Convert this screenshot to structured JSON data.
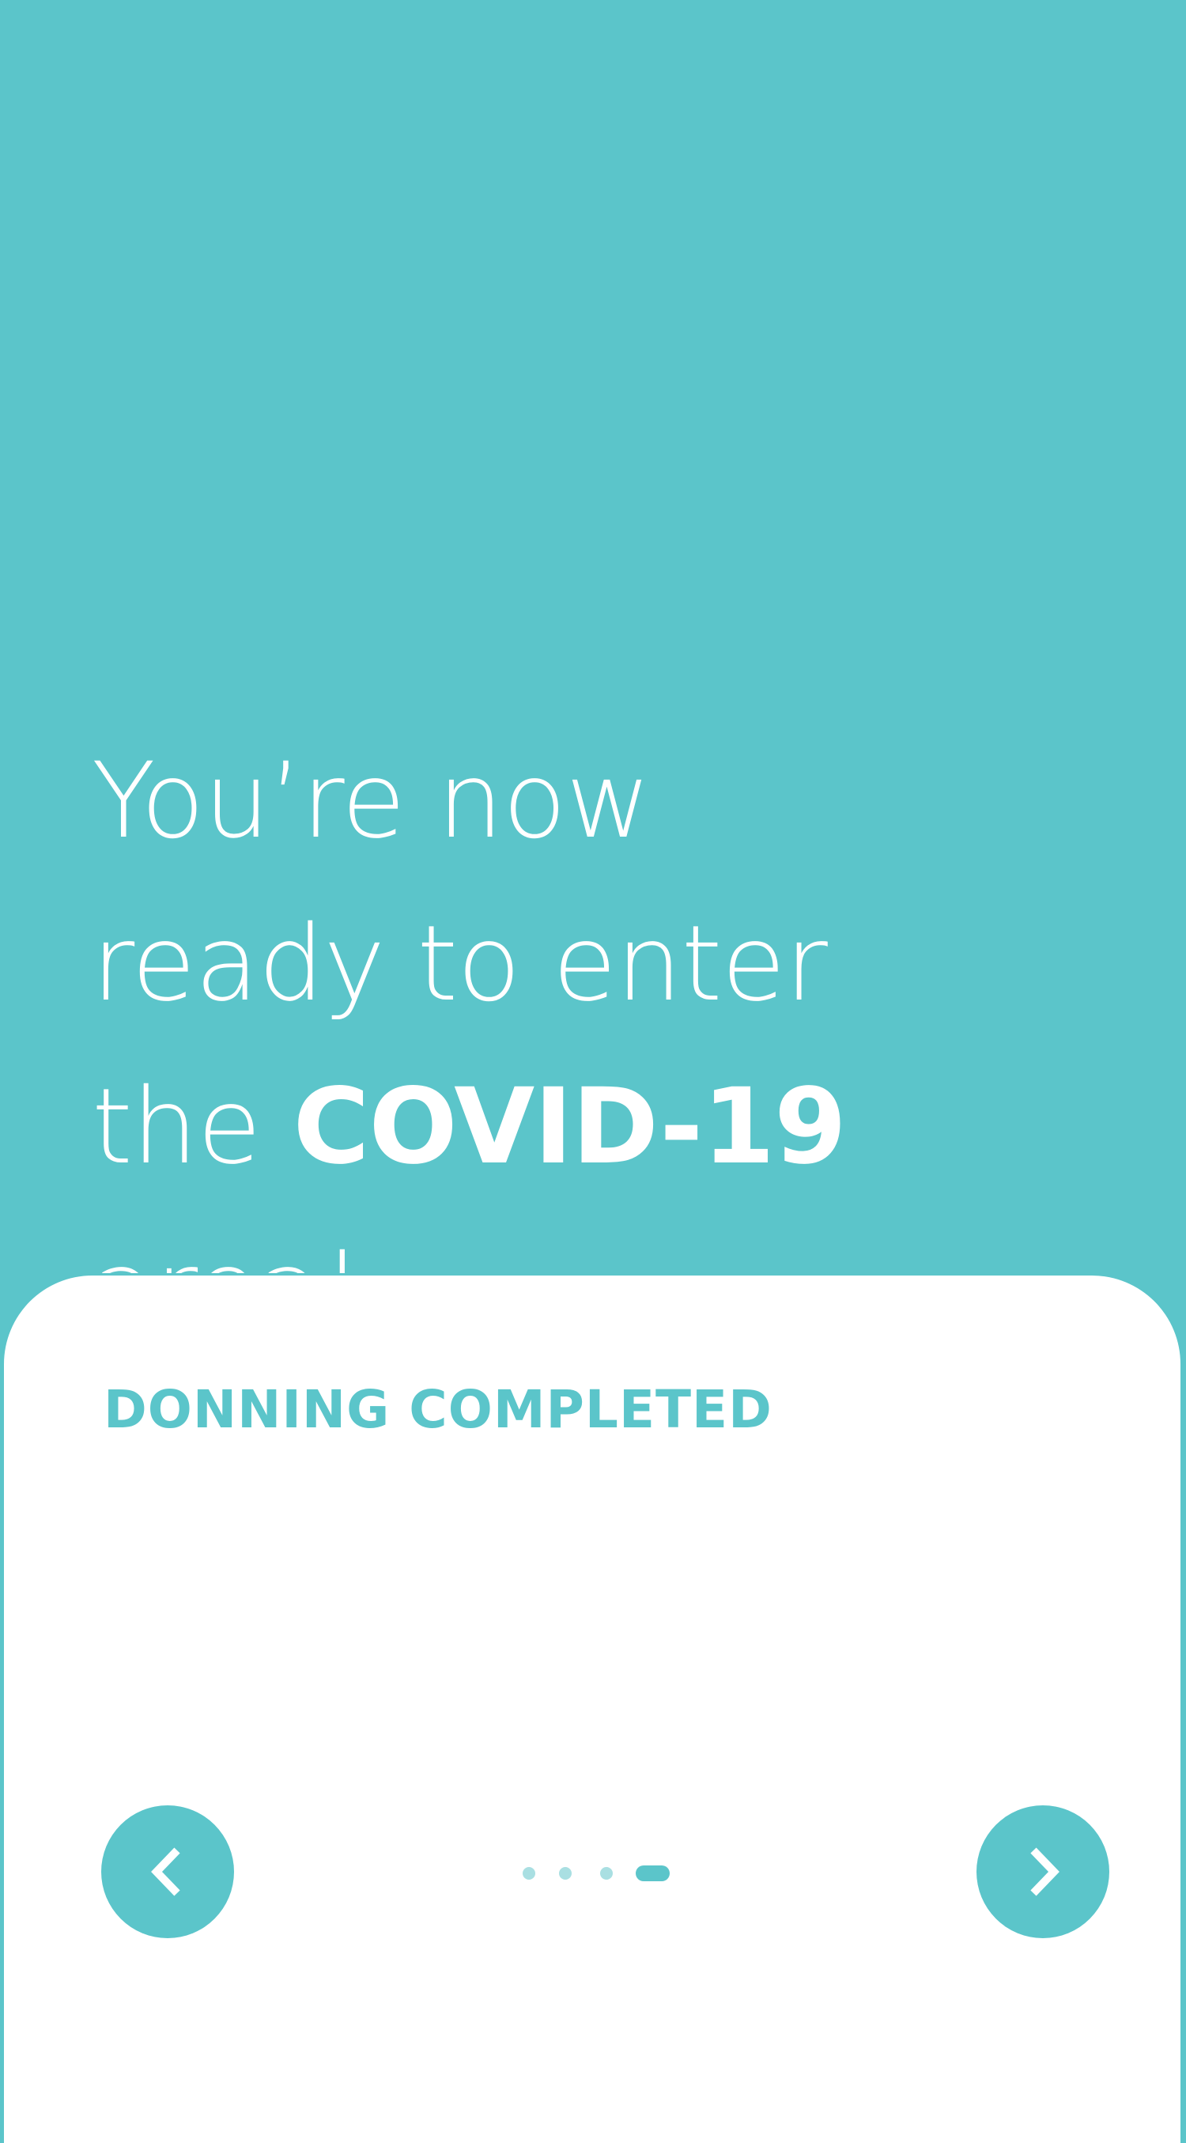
{
  "headline": {
    "line1": "You’re now",
    "line2": "ready to enter",
    "line3_pre": "the ",
    "line3_bold": "COVID-19",
    "line3_post": " area!"
  },
  "card": {
    "title": "DONNING COMPLETED"
  },
  "navigation": {
    "prev_icon": "chevron-left-icon",
    "next_icon": "chevron-right-icon",
    "page_count": 4,
    "current_page": 4
  },
  "colors": {
    "accent": "#5BC5CA",
    "dot_inactive": "#A9DFE2",
    "card_background": "#FFFFFF",
    "text_on_accent": "#FFFFFF"
  }
}
